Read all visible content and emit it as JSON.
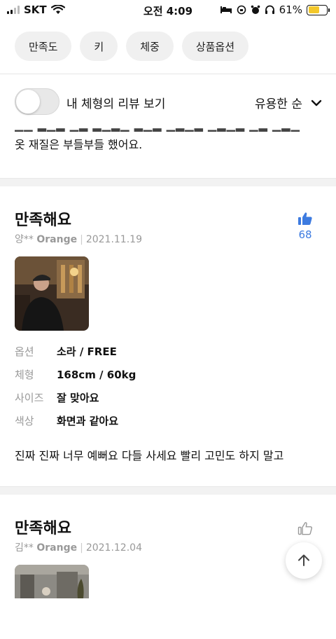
{
  "status_bar": {
    "carrier": "SKT",
    "time": "오전 4:09",
    "battery_percent": "61%",
    "battery_level": 0.61
  },
  "filter_chips": [
    "만족도",
    "키",
    "체중",
    "상품옵션"
  ],
  "body_type_toggle": {
    "label": "내 체형의 리뷰 보기",
    "on": false
  },
  "sort": {
    "label": "유용한 순"
  },
  "previous_review_tail": "옷 재질은 부들부들 했어요.",
  "reviews": [
    {
      "title": "만족해요",
      "user": "양**",
      "grade": "Orange",
      "date": "2021.11.19",
      "likes": "68",
      "liked": true,
      "options": [
        {
          "key": "옵션",
          "value": "소라 / FREE"
        },
        {
          "key": "체형",
          "value": "168cm / 60kg"
        },
        {
          "key": "사이즈",
          "value": "잘 맞아요"
        },
        {
          "key": "색상",
          "value": "화면과 같아요"
        }
      ],
      "text": "진짜 진짜 너무 예뻐요 다들 사세요 빨리 고민도 하지 말고"
    },
    {
      "title": "만족해요",
      "user": "김**",
      "grade": "Orange",
      "date": "2021.12.04",
      "liked": false
    }
  ],
  "colors": {
    "accent": "#3d7be0",
    "chip_bg": "#f0f0f0",
    "battery": "#f3c72a"
  }
}
